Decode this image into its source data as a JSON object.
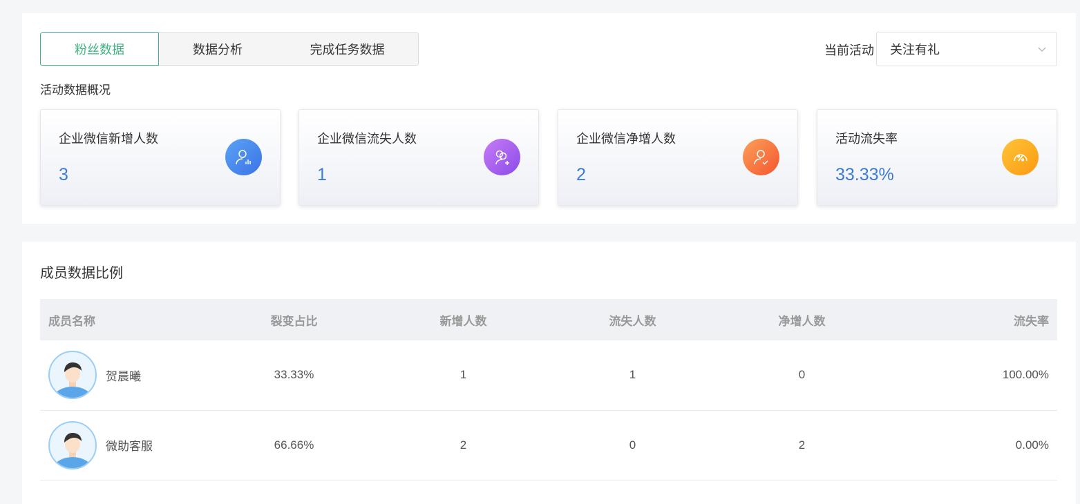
{
  "tabs": [
    {
      "label": "粉丝数据",
      "active": true
    },
    {
      "label": "数据分析",
      "active": false
    },
    {
      "label": "完成任务数据",
      "active": false
    }
  ],
  "activity": {
    "label": "当前活动",
    "selected": "关注有礼"
  },
  "overview": {
    "title": "活动数据概况",
    "cards": [
      {
        "label": "企业微信新增人数",
        "value": "3",
        "icon": "user-chart-icon",
        "gradient": [
          "#5aa3f5",
          "#3b73e6"
        ]
      },
      {
        "label": "企业微信流失人数",
        "value": "1",
        "icon": "user-plus-icon",
        "gradient": [
          "#c77bf6",
          "#8a4be8"
        ]
      },
      {
        "label": "企业微信净增人数",
        "value": "2",
        "icon": "user-check-icon",
        "gradient": [
          "#fba05a",
          "#f5562e"
        ]
      },
      {
        "label": "活动流失率",
        "value": "33.33%",
        "icon": "percent-gauge-icon",
        "gradient": [
          "#ffc43a",
          "#fb9a10"
        ]
      }
    ]
  },
  "members": {
    "title": "成员数据比例",
    "columns": [
      "成员名称",
      "裂变占比",
      "新增人数",
      "流失人数",
      "净增人数",
      "流失率"
    ],
    "rows": [
      {
        "name": "贺晨曦",
        "ratio": "33.33%",
        "new": "1",
        "lost": "1",
        "net": "0",
        "rate": "100.00%"
      },
      {
        "name": "微助客服",
        "ratio": "66.66%",
        "new": "2",
        "lost": "0",
        "net": "2",
        "rate": "0.00%"
      }
    ]
  },
  "colors": {
    "accent": "#3fb27f",
    "value_blue": "#3c7bd8"
  }
}
